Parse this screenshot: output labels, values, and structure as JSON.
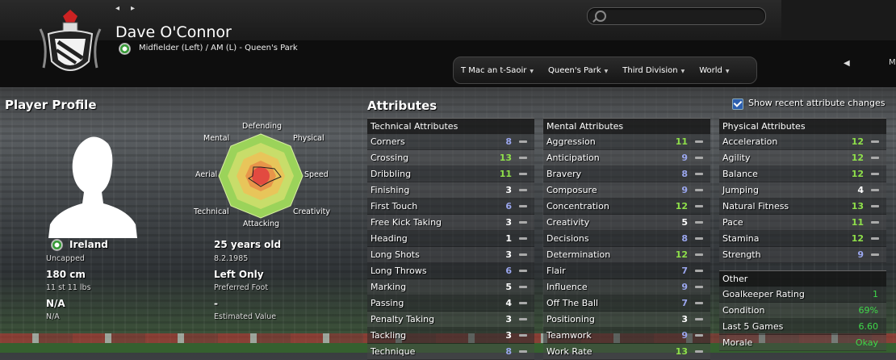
{
  "header": {
    "player_name": "Dave O'Connor",
    "position_club": "Midfielder (Left) / AM (L) - Queen's Park",
    "nav_prev": "◂",
    "nav_next": "▸",
    "search_placeholder": "",
    "breadcrumbs": [
      {
        "label": "T Mac an t-Saoir"
      },
      {
        "label": "Queen's Park"
      },
      {
        "label": "Third Division"
      },
      {
        "label": "World"
      }
    ],
    "back_arrow": "◀",
    "right_cut_letter": "M"
  },
  "profile": {
    "title": "Player Profile",
    "nationality": "Ireland",
    "caps": "Uncapped",
    "height": "180 cm",
    "weight": "11 st 11 lbs",
    "value_main": "N/A",
    "value_sub": "N/A",
    "age": "25 years old",
    "dob": "8.2.1985",
    "foot": "Left Only",
    "foot_label": "Preferred Foot",
    "est_value": "-",
    "est_value_label": "Estimated Value",
    "radar_labels": {
      "defending": "Defending",
      "physical": "Physical",
      "speed": "Speed",
      "creativity": "Creativity",
      "attacking": "Attacking",
      "technical": "Technical",
      "aerial": "Aerial",
      "mental": "Mental"
    }
  },
  "attributes": {
    "title": "Attributes",
    "show_recent_label": "Show recent attribute changes",
    "show_recent_checked": true,
    "technical": {
      "heading": "Technical Attributes",
      "rows": [
        {
          "name": "Corners",
          "value": "8",
          "color": "blue"
        },
        {
          "name": "Crossing",
          "value": "13",
          "color": "green"
        },
        {
          "name": "Dribbling",
          "value": "11",
          "color": "green"
        },
        {
          "name": "Finishing",
          "value": "3",
          "color": "white"
        },
        {
          "name": "First Touch",
          "value": "6",
          "color": "blue"
        },
        {
          "name": "Free Kick Taking",
          "value": "3",
          "color": "white"
        },
        {
          "name": "Heading",
          "value": "1",
          "color": "white"
        },
        {
          "name": "Long Shots",
          "value": "3",
          "color": "white"
        },
        {
          "name": "Long Throws",
          "value": "6",
          "color": "blue"
        },
        {
          "name": "Marking",
          "value": "5",
          "color": "white"
        },
        {
          "name": "Passing",
          "value": "4",
          "color": "white"
        },
        {
          "name": "Penalty Taking",
          "value": "3",
          "color": "white"
        },
        {
          "name": "Tackling",
          "value": "3",
          "color": "white"
        },
        {
          "name": "Technique",
          "value": "8",
          "color": "blue"
        }
      ]
    },
    "mental": {
      "heading": "Mental Attributes",
      "rows": [
        {
          "name": "Aggression",
          "value": "11",
          "color": "green"
        },
        {
          "name": "Anticipation",
          "value": "9",
          "color": "blue"
        },
        {
          "name": "Bravery",
          "value": "8",
          "color": "blue"
        },
        {
          "name": "Composure",
          "value": "9",
          "color": "blue"
        },
        {
          "name": "Concentration",
          "value": "12",
          "color": "green"
        },
        {
          "name": "Creativity",
          "value": "5",
          "color": "white"
        },
        {
          "name": "Decisions",
          "value": "8",
          "color": "blue"
        },
        {
          "name": "Determination",
          "value": "12",
          "color": "green"
        },
        {
          "name": "Flair",
          "value": "7",
          "color": "blue"
        },
        {
          "name": "Influence",
          "value": "9",
          "color": "blue"
        },
        {
          "name": "Off The Ball",
          "value": "7",
          "color": "blue"
        },
        {
          "name": "Positioning",
          "value": "3",
          "color": "white"
        },
        {
          "name": "Teamwork",
          "value": "9",
          "color": "blue"
        },
        {
          "name": "Work Rate",
          "value": "13",
          "color": "green"
        }
      ]
    },
    "physical": {
      "heading": "Physical Attributes",
      "rows": [
        {
          "name": "Acceleration",
          "value": "12",
          "color": "green"
        },
        {
          "name": "Agility",
          "value": "12",
          "color": "green"
        },
        {
          "name": "Balance",
          "value": "12",
          "color": "green"
        },
        {
          "name": "Jumping",
          "value": "4",
          "color": "white"
        },
        {
          "name": "Natural Fitness",
          "value": "13",
          "color": "green"
        },
        {
          "name": "Pace",
          "value": "11",
          "color": "green"
        },
        {
          "name": "Stamina",
          "value": "12",
          "color": "green"
        },
        {
          "name": "Strength",
          "value": "9",
          "color": "blue"
        }
      ]
    },
    "other": {
      "heading": "Other",
      "rows": [
        {
          "name": "Goalkeeper Rating",
          "value": "1"
        },
        {
          "name": "Condition",
          "value": "69%"
        },
        {
          "name": "Last 5 Games",
          "value": "6.60"
        },
        {
          "name": "Morale",
          "value": "Okay"
        }
      ]
    }
  },
  "colors": {
    "value_blue": "#9aa6ee",
    "value_green": "#8fe04a",
    "value_white": "#ffffff",
    "other_green": "#3fd84a"
  }
}
